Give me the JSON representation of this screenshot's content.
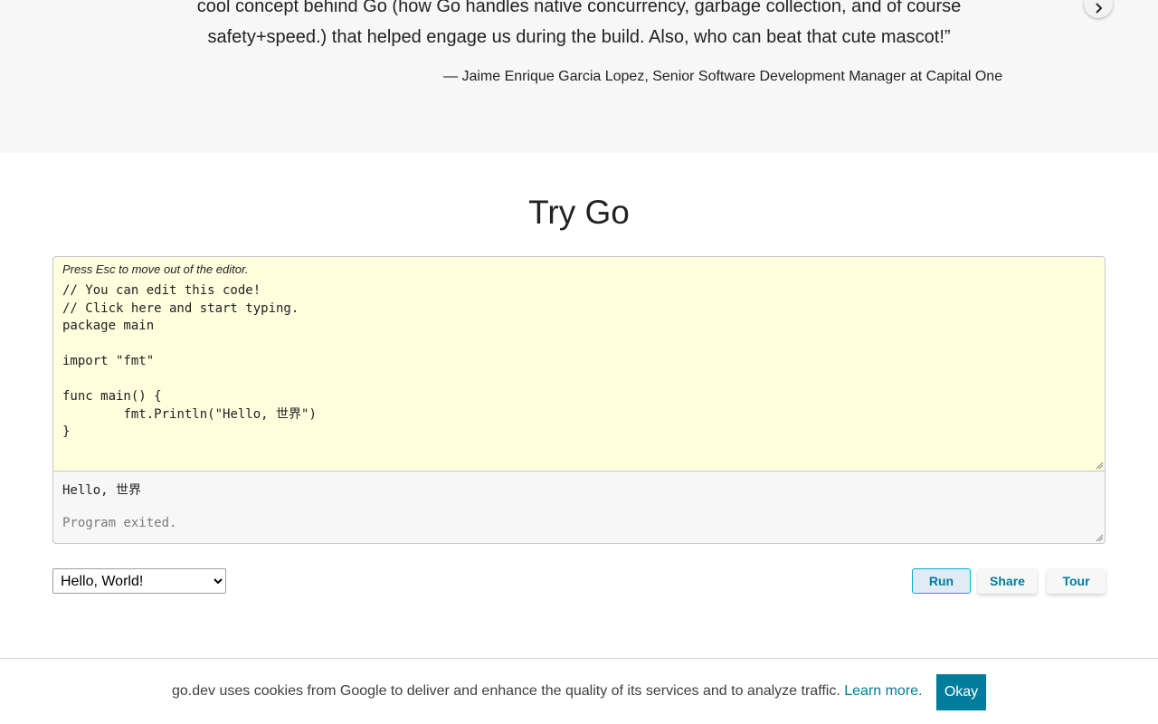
{
  "quote": {
    "line1": "cool concept behind Go (how Go handles native concurrency, garbage collection, and of course",
    "line2": "safety+speed.) that helped engage us during the build. Also, who can beat that cute mascot!”",
    "author": "— Jaime Enrique Garcia Lopez, Senior Software Development Manager at Capital One",
    "next_icon": "chevron-right-icon"
  },
  "try_go": {
    "title": "Try Go",
    "editor_hint": "Press Esc to move out of the editor.",
    "code": "// You can edit this code!\n// Click here and start typing.\npackage main\n\nimport \"fmt\"\n\nfunc main() {\n\tfmt.Println(\"Hello, 世界\")\n}",
    "output_line1": "Hello, 世界",
    "output_line2": "Program exited.",
    "example_selected": "Hello, World!",
    "run_label": "Run",
    "share_label": "Share",
    "tour_label": "Tour"
  },
  "cookie_bar": {
    "text": "go.dev uses cookies from Google to deliver and enhance the quality of its services and to analyze traffic.",
    "link_label": "Learn more.",
    "okay_label": "Okay"
  },
  "colors": {
    "accent": "#007d9c",
    "editor_bg": "#ffffdd",
    "section_bg": "#f7f7f7"
  }
}
